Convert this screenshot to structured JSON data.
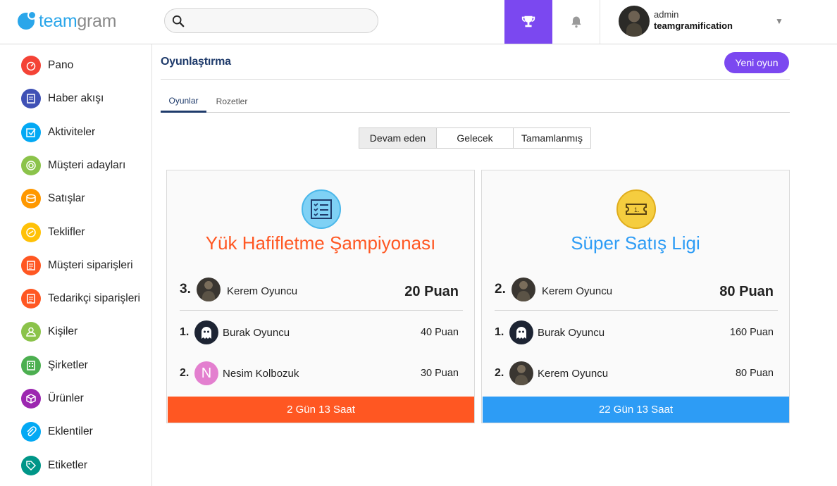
{
  "app": {
    "logo_part1": "team",
    "logo_part2": "gram"
  },
  "header": {
    "search_placeholder": "",
    "user_role": "admin",
    "user_name": "teamgramification"
  },
  "sidebar": {
    "items": [
      {
        "label": "Pano",
        "color": "#f44336"
      },
      {
        "label": "Haber akışı",
        "color": "#3f51b5"
      },
      {
        "label": "Aktiviteler",
        "color": "#03a9f4"
      },
      {
        "label": "Müşteri adayları",
        "color": "#8bc34a"
      },
      {
        "label": "Satışlar",
        "color": "#ff9800"
      },
      {
        "label": "Teklifler",
        "color": "#ffc107"
      },
      {
        "label": "Müşteri siparişleri",
        "color": "#ff5722"
      },
      {
        "label": "Tedarikçi siparişleri",
        "color": "#ff5722"
      },
      {
        "label": "Kişiler",
        "color": "#8bc34a"
      },
      {
        "label": "Şirketler",
        "color": "#4caf50"
      },
      {
        "label": "Ürünler",
        "color": "#9c27b0"
      },
      {
        "label": "Eklentiler",
        "color": "#03a9f4"
      },
      {
        "label": "Etiketler",
        "color": "#009688"
      }
    ]
  },
  "main": {
    "title": "Oyunlaştırma",
    "new_game_label": "Yeni oyun",
    "tabs": [
      {
        "label": "Oyunlar"
      },
      {
        "label": "Rozetler"
      }
    ],
    "filters": [
      {
        "label": "Devam eden"
      },
      {
        "label": "Gelecek"
      },
      {
        "label": "Tamamlanmış"
      }
    ]
  },
  "cards": [
    {
      "title": "Yük Hafifletme Şampiyonası",
      "accent": "#ff5722",
      "icon": "checklist-icon",
      "leader": {
        "rank": "3.",
        "name": "Kerem Oyuncu",
        "score": "20 Puan"
      },
      "rows": [
        {
          "rank": "1.",
          "name": "Burak Oyuncu",
          "score": "40 Puan",
          "avatar": "ghost"
        },
        {
          "rank": "2.",
          "name": "Nesim Kolbozuk",
          "score": "30 Puan",
          "avatar": "letter",
          "letter": "N"
        }
      ],
      "footer": "2 Gün 13 Saat"
    },
    {
      "title": "Süper Satış Ligi",
      "accent": "#2d9cf5",
      "icon": "ticket-icon",
      "leader": {
        "rank": "2.",
        "name": "Kerem Oyuncu",
        "score": "80 Puan"
      },
      "rows": [
        {
          "rank": "1.",
          "name": "Burak Oyuncu",
          "score": "160 Puan",
          "avatar": "ghost"
        },
        {
          "rank": "2.",
          "name": "Kerem Oyuncu",
          "score": "80 Puan",
          "avatar": "photo"
        }
      ],
      "footer": "22 Gün 13 Saat"
    }
  ]
}
